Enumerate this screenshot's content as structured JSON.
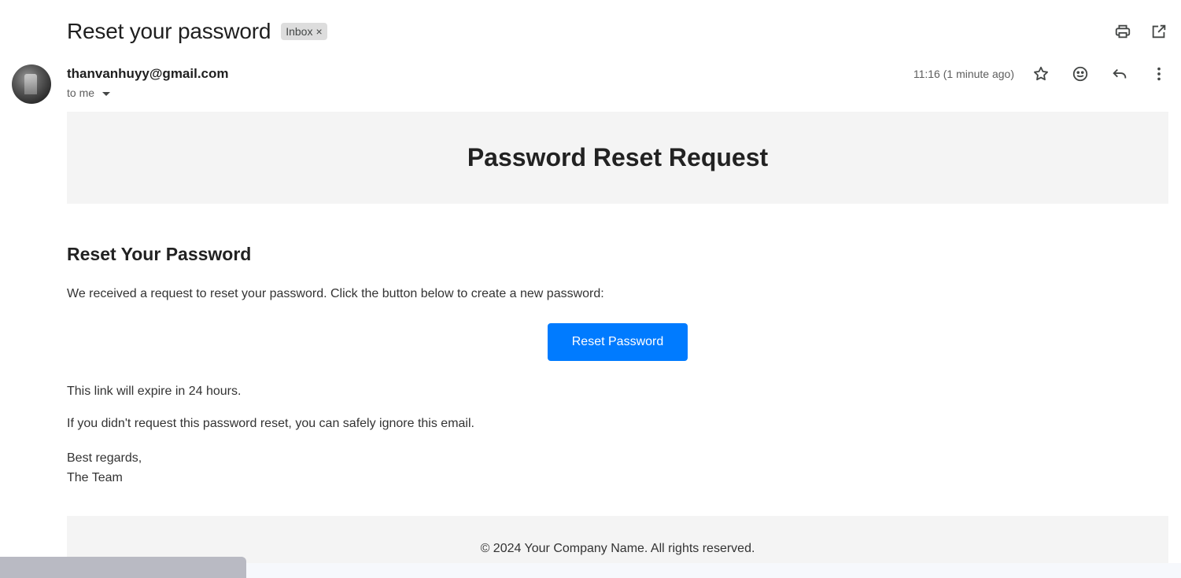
{
  "email": {
    "subject": "Reset your password",
    "label": "Inbox",
    "label_remove": "×",
    "sender": "thanvanhuyy@gmail.com",
    "recipient": "to me",
    "timestamp": "11:16 (1 minute ago)"
  },
  "icons": {
    "print": "print-icon",
    "open_new_window": "open-in-new-window-icon",
    "star": "star-icon",
    "emoji": "emoji-reaction-icon",
    "reply": "reply-icon",
    "more": "more-vertical-icon",
    "caret": "chevron-down-icon"
  },
  "body": {
    "banner_title": "Password Reset Request",
    "heading": "Reset Your Password",
    "intro": "We received a request to reset your password. Click the button below to create a new password:",
    "button_label": "Reset Password",
    "expiry": "This link will expire in 24 hours.",
    "ignore_note": "If you didn't request this password reset, you can safely ignore this email.",
    "closing": "Best regards,",
    "signature": "The Team",
    "footer": "© 2024 Your Company Name. All rights reserved."
  },
  "colors": {
    "button": "#007bff",
    "band": "#f4f4f4"
  }
}
